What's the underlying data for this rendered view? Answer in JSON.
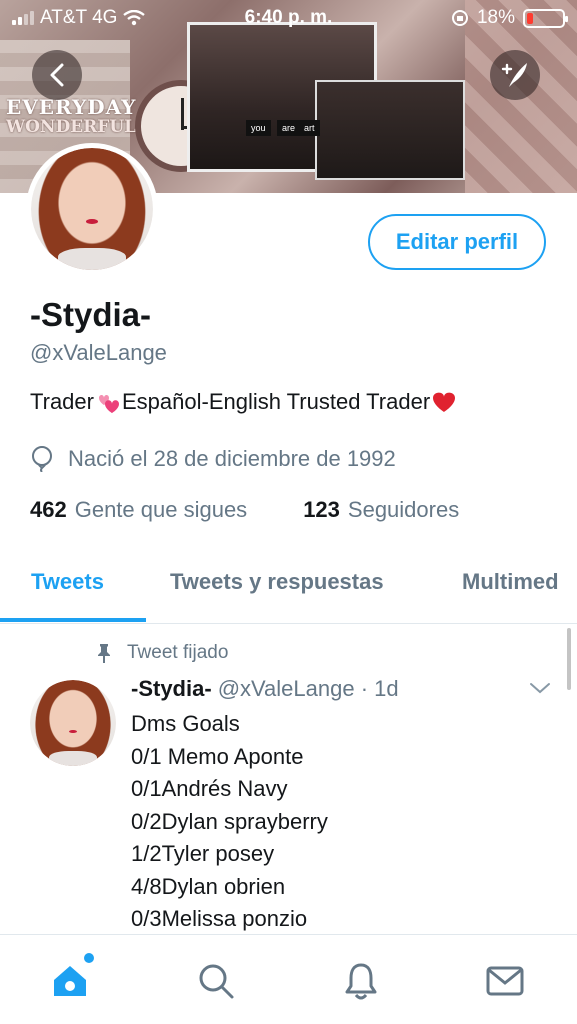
{
  "status_bar": {
    "carrier": "AT&T 4G",
    "time": "6:40 p. m.",
    "battery": "18%",
    "battery_level": 0.18
  },
  "banner": {
    "word1": "EVERYDAY",
    "word2": "WONDERFUL",
    "tags": [
      "you",
      "are",
      "art"
    ]
  },
  "profile": {
    "edit_label": "Editar perfil",
    "name": "-Stydia-",
    "handle": "@xValeLange",
    "bio_part1": "Trader",
    "bio_part2": "Español-English Trusted Trader",
    "born": "Nació el 28 de diciembre de 1992",
    "following_count": "462",
    "following_label": "Gente que sigues",
    "followers_count": "123",
    "followers_label": "Seguidores"
  },
  "tabs": [
    {
      "label": "Tweets",
      "active": true
    },
    {
      "label": "Tweets y respuestas",
      "active": false
    },
    {
      "label": "Multimed",
      "active": false
    }
  ],
  "tweet": {
    "pinned_label": "Tweet fijado",
    "name": "-Stydia-",
    "meta": "@xValeLange · 1d",
    "lines": [
      "Dms Goals",
      "0/1 Memo Aponte",
      "0/1Andrés Navy",
      "0/2Dylan sprayberry",
      "1/2Tyler posey",
      "4/8Dylan obrien",
      "0/3Melissa ponzio"
    ]
  },
  "colors": {
    "accent": "#1da1f2",
    "secondary_text": "#657786",
    "battery_low": "#ff3b30"
  },
  "icons": {
    "back": "chevron-left-icon",
    "compose": "compose-tweet-icon",
    "birthday": "balloon-icon",
    "pin": "pin-icon",
    "chevron": "chevron-down-icon",
    "nav": [
      "home-icon",
      "search-icon",
      "bell-icon",
      "mail-icon"
    ]
  }
}
